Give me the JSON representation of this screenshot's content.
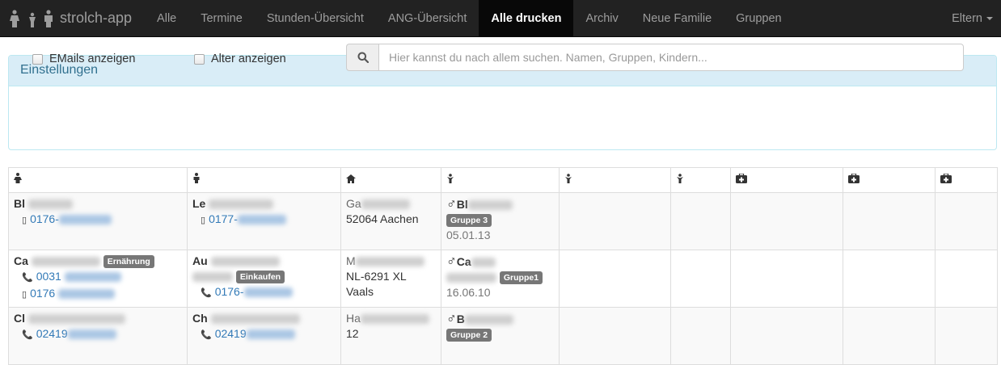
{
  "navbar": {
    "brand": "strolch-app",
    "items": [
      {
        "label": "Alle",
        "active": false
      },
      {
        "label": "Termine",
        "active": false
      },
      {
        "label": "Stunden-Übersicht",
        "active": false
      },
      {
        "label": "ANG-Übersicht",
        "active": false
      },
      {
        "label": "Alle drucken",
        "active": true
      },
      {
        "label": "Archiv",
        "active": false
      },
      {
        "label": "Neue Familie",
        "active": false
      },
      {
        "label": "Gruppen",
        "active": false
      }
    ],
    "right_menu": "Eltern"
  },
  "settings": {
    "title": "Einstellungen",
    "show_emails_label": "EMails anzeigen",
    "show_age_label": "Alter anzeigen",
    "search_placeholder": "Hier kannst du nach allem suchen. Namen, Gruppen, Kindern..."
  },
  "table": {
    "header_icons": [
      "mother-icon",
      "father-icon",
      "home-icon",
      "child-icon",
      "child-icon",
      "child-icon",
      "medical-kit-icon",
      "medical-kit-icon",
      "medical-kit-icon"
    ],
    "rows": [
      {
        "mother": {
          "name": "Bl",
          "tags": [],
          "phones": [
            {
              "type": "mobile",
              "number": "0176-"
            }
          ]
        },
        "father": {
          "name": "Le",
          "tags": [],
          "phones": [
            {
              "type": "mobile",
              "number": "0177-"
            }
          ]
        },
        "address": {
          "street": "Ga",
          "city_lines": [
            "52064 Aachen"
          ]
        },
        "child": {
          "gender_symbol": "♂",
          "name": "Bl",
          "group": "Gruppe 3",
          "group_inline": false,
          "birthdate": "05.01.13"
        }
      },
      {
        "mother": {
          "name": "Ca",
          "tags": [
            "Ernährung"
          ],
          "phones": [
            {
              "type": "phone",
              "number": "0031"
            },
            {
              "type": "mobile",
              "number": "0176"
            }
          ]
        },
        "father": {
          "name": "Au",
          "tags": [
            "Einkaufen"
          ],
          "phones": [
            {
              "type": "phone",
              "number": "0176-"
            }
          ]
        },
        "address": {
          "street": "M",
          "city_lines": [
            "NL-6291 XL",
            "Vaals"
          ]
        },
        "child": {
          "gender_symbol": "♂",
          "name": "Ca",
          "group": "Gruppe1",
          "group_inline": true,
          "birthdate": "16.06.10"
        }
      },
      {
        "mother": {
          "name": "Cl",
          "tags": [],
          "phones": [
            {
              "type": "phone",
              "number": "02419"
            }
          ]
        },
        "father": {
          "name": "Ch",
          "tags": [],
          "phones": [
            {
              "type": "phone",
              "number": "02419"
            }
          ]
        },
        "address": {
          "street": "Ha",
          "city_lines": [
            "12"
          ]
        },
        "child": {
          "gender_symbol": "♂",
          "name": "B",
          "group": "Gruppe 2",
          "group_inline": false,
          "birthdate": ""
        }
      }
    ]
  },
  "colors": {
    "navbar_bg": "#222222",
    "navbar_active_bg": "#080808",
    "panel_heading_bg": "#d9edf7",
    "panel_heading_text": "#31708f",
    "link": "#337ab7",
    "tag_bg": "#777777"
  }
}
